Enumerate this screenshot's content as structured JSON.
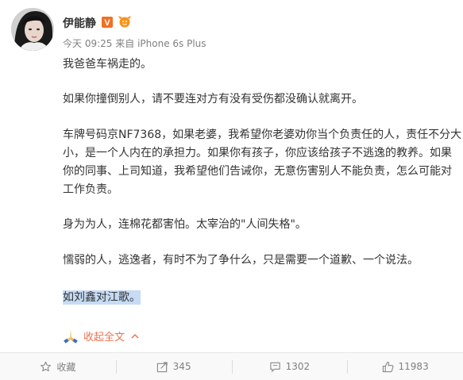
{
  "author": {
    "name": "伊能静",
    "verified_badge": "V",
    "badge_color": "#f27022"
  },
  "meta": {
    "time": "今天 09:25",
    "via": "来自",
    "client": "iPhone 6s Plus"
  },
  "content": {
    "p1": "我爸爸车祸走的。",
    "p2": "如果你撞倒别人，请不要连对方有没有受伤都没确认就离开。",
    "p3_lines": [
      "车牌号码京NF7368，如果老婆，我希望你老婆劝你当个负责任的人，责任不分大",
      "小，是一个人内在的承担力。如果你有孩子，你应该给孩子不逃逸的教养。如果",
      "你的同事、上司知道，我希望他们告诫你，无意伤害别人不能负责，怎么可能对",
      "工作负责。"
    ],
    "p4": "身为为人，连棉花都害怕。太宰治的\"人间失格\"。",
    "p5": "懦弱的人，逃逸者，有时不为了争什么，只是需要一个道歉、一个说法。",
    "p6": "如刘鑫对江歌。",
    "highlight_color": "#c6dbf5"
  },
  "collapse": {
    "label": "收起全文",
    "icon": "praying-hands-icon",
    "color": "#eb7350"
  },
  "footer": {
    "favorite": {
      "label": "收藏",
      "icon": "star-icon"
    },
    "repost": {
      "count": "345",
      "icon": "share-icon"
    },
    "comment": {
      "count": "1302",
      "icon": "comment-icon"
    },
    "like": {
      "count": "11983",
      "icon": "thumbs-up-icon"
    }
  }
}
